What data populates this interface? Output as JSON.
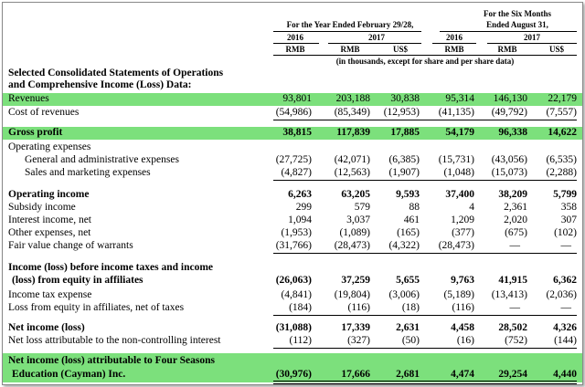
{
  "header": {
    "year_group": "For the Year Ended February 29/28,",
    "six_group_line1": "For the Six Months",
    "six_group_line2": "Ended August 31,",
    "years": [
      "2016",
      "2017",
      "2016",
      "2017"
    ],
    "currencies": [
      "RMB",
      "RMB",
      "US$",
      "RMB",
      "RMB",
      "US$"
    ],
    "note": "(in thousands, except for share and per share data)"
  },
  "section1_title_line1": "Selected Consolidated Statements of Operations",
  "section1_title_line2": "and Comprehensive Income (Loss) Data:",
  "rows": [
    {
      "label": "Revenues",
      "values": [
        "93,801",
        "203,188",
        "30,838",
        "95,314",
        "146,130",
        "22,179"
      ]
    },
    {
      "label": "Cost of revenues",
      "values": [
        "(54,986)",
        "(85,349)",
        "(12,953)",
        "(41,135)",
        "(49,792)",
        "(7,557)"
      ]
    },
    {
      "label": "Gross profit",
      "values": [
        "38,815",
        "117,839",
        "17,885",
        "54,179",
        "96,338",
        "14,622"
      ]
    },
    {
      "label": "Operating expenses",
      "values": [
        "",
        "",
        "",
        "",
        "",
        ""
      ]
    },
    {
      "label": "General and administrative expenses",
      "values": [
        "(27,725)",
        "(42,071)",
        "(6,385)",
        "(15,731)",
        "(43,056)",
        "(6,535)"
      ]
    },
    {
      "label": "Sales and marketing expenses",
      "values": [
        "(4,827)",
        "(12,563)",
        "(1,907)",
        "(1,048)",
        "(15,073)",
        "(2,288)"
      ]
    },
    {
      "label": "Operating income",
      "values": [
        "6,263",
        "63,205",
        "9,593",
        "37,400",
        "38,209",
        "5,799"
      ]
    },
    {
      "label": "Subsidy income",
      "values": [
        "299",
        "579",
        "88",
        "4",
        "2,361",
        "358"
      ]
    },
    {
      "label": "Interest income, net",
      "values": [
        "1,094",
        "3,037",
        "461",
        "1,209",
        "2,020",
        "307"
      ]
    },
    {
      "label": "Other expenses, net",
      "values": [
        "(1,953)",
        "(1,089)",
        "(165)",
        "(377)",
        "(675)",
        "(102)"
      ]
    },
    {
      "label": "Fair value change of warrants",
      "values": [
        "(31,766)",
        "(28,473)",
        "(4,322)",
        "(28,473)",
        "—",
        "—"
      ]
    },
    {
      "label": "Income (loss) before income taxes and income",
      "values": [
        "",
        "",
        "",
        "",
        "",
        ""
      ]
    },
    {
      "label": "(loss) from equity in affiliates",
      "values": [
        "(26,063)",
        "37,259",
        "5,655",
        "9,763",
        "41,915",
        "6,362"
      ]
    },
    {
      "label": "Income tax expense",
      "values": [
        "(4,841)",
        "(19,804)",
        "(3,006)",
        "(5,189)",
        "(13,413)",
        "(2,036)"
      ]
    },
    {
      "label": "Loss from equity in affiliates, net of taxes",
      "values": [
        "(184)",
        "(116)",
        "(18)",
        "(116)",
        "—",
        "—"
      ]
    },
    {
      "label": "Net income (loss)",
      "values": [
        "(31,088)",
        "17,339",
        "2,631",
        "4,458",
        "28,502",
        "4,326"
      ]
    },
    {
      "label": "Net loss attributable to the non-controlling interest",
      "values": [
        "(112)",
        "(327)",
        "(50)",
        "(16)",
        "(752)",
        "(144)"
      ]
    },
    {
      "label": "Net income (loss) attributable to Four Seasons",
      "values": [
        "",
        "",
        "",
        "",
        "",
        ""
      ]
    },
    {
      "label": "Education (Cayman) Inc.",
      "values": [
        "(30,976)",
        "17,666",
        "2,681",
        "4,474",
        "29,254",
        "4,440"
      ]
    }
  ],
  "colors": {
    "highlight": "#7ce07c",
    "text": "#000000"
  }
}
